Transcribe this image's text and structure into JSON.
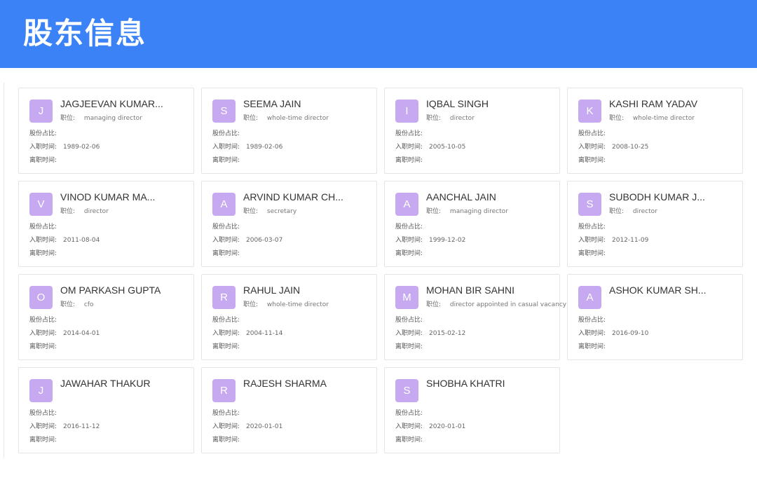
{
  "header": {
    "title": "股东信息"
  },
  "labels": {
    "position": "职位:",
    "share_ratio": "股份占比:",
    "join_date": "入职时间:",
    "leave_date": "离职时间:"
  },
  "colors": {
    "header_bg": "#3a82f6",
    "avatar_bg": "#c6a9f0"
  },
  "cards": [
    {
      "initial": "J",
      "name": "JAGJEEVAN KUMAR...",
      "position": "managing director",
      "share": "",
      "join": "1989-02-06",
      "leave": ""
    },
    {
      "initial": "S",
      "name": "SEEMA JAIN",
      "position": "whole-time director",
      "share": "",
      "join": "1989-02-06",
      "leave": ""
    },
    {
      "initial": "I",
      "name": "IQBAL SINGH",
      "position": "director",
      "share": "",
      "join": "2005-10-05",
      "leave": ""
    },
    {
      "initial": "K",
      "name": "KASHI RAM YADAV",
      "position": "whole-time director",
      "share": "",
      "join": "2008-10-25",
      "leave": ""
    },
    {
      "initial": "V",
      "name": "VINOD KUMAR MA...",
      "position": "director",
      "share": "",
      "join": "2011-08-04",
      "leave": ""
    },
    {
      "initial": "A",
      "name": "ARVIND KUMAR CH...",
      "position": "secretary",
      "share": "",
      "join": "2006-03-07",
      "leave": ""
    },
    {
      "initial": "A",
      "name": "AANCHAL JAIN",
      "position": "managing director",
      "share": "",
      "join": "1999-12-02",
      "leave": ""
    },
    {
      "initial": "S",
      "name": "SUBODH KUMAR J...",
      "position": "director",
      "share": "",
      "join": "2012-11-09",
      "leave": ""
    },
    {
      "initial": "O",
      "name": "OM PARKASH GUPTA",
      "position": "cfo",
      "share": "",
      "join": "2014-04-01",
      "leave": ""
    },
    {
      "initial": "R",
      "name": "RAHUL JAIN",
      "position": "whole-time director",
      "share": "",
      "join": "2004-11-14",
      "leave": ""
    },
    {
      "initial": "M",
      "name": "MOHAN BIR SAHNI",
      "position": "director appointed in casual vacancy",
      "share": "",
      "join": "2015-02-12",
      "leave": ""
    },
    {
      "initial": "A",
      "name": "ASHOK KUMAR SH...",
      "position": null,
      "share": "",
      "join": "2016-09-10",
      "leave": ""
    },
    {
      "initial": "J",
      "name": "JAWAHAR THAKUR",
      "position": null,
      "share": "",
      "join": "2016-11-12",
      "leave": ""
    },
    {
      "initial": "R",
      "name": "RAJESH SHARMA",
      "position": null,
      "share": "",
      "join": "2020-01-01",
      "leave": ""
    },
    {
      "initial": "S",
      "name": "SHOBHA KHATRI",
      "position": null,
      "share": "",
      "join": "2020-01-01",
      "leave": ""
    }
  ]
}
